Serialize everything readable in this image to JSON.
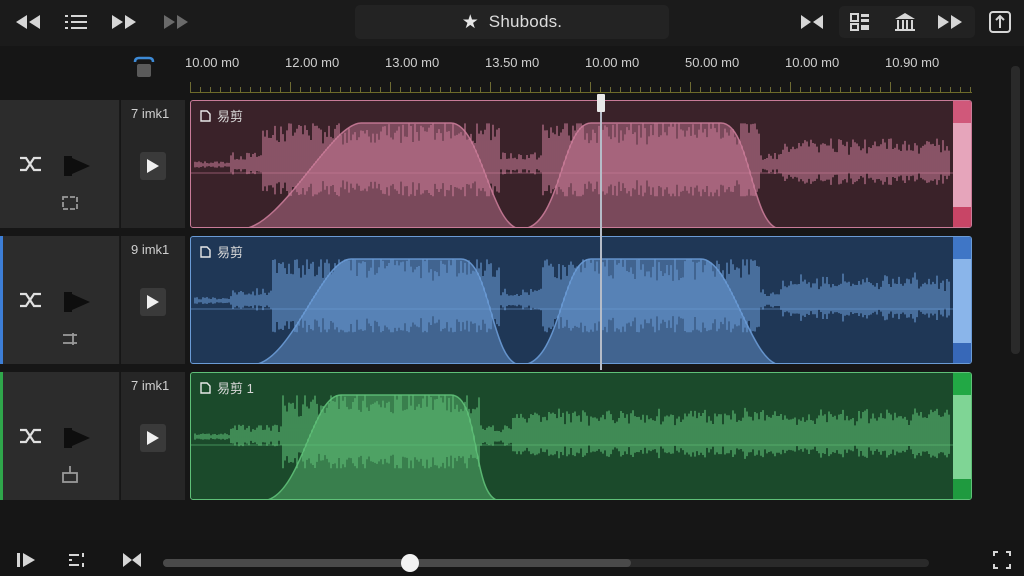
{
  "header": {
    "title": "Shubods.",
    "title_icon": "star-icon",
    "left_buttons": [
      "rewind-icon",
      "list-icon",
      "fast-forward-icon",
      "skip-forward-icon"
    ],
    "right_buttons": [
      "split-icon",
      "grid-icon",
      "bank-icon",
      "forward-icon",
      "share-icon"
    ]
  },
  "ruler": {
    "labels": [
      "10.00 m0",
      "12.00 m0",
      "13.00 m0",
      "13.50 m0",
      "10.00 m0",
      "50.00 m0",
      "10.00 m0",
      "10.90 m0"
    ]
  },
  "tracks": [
    {
      "number": "7 imk1",
      "clip_name": "易剪",
      "color": "#c97b98",
      "bg": "#3a2229",
      "side": "#c94d6b"
    },
    {
      "number": "9 imk1",
      "clip_name": "易剪",
      "color": "#6a9bd6",
      "bg": "#1f3756",
      "side": "#4a7fca"
    },
    {
      "number": "7 imk1",
      "clip_name": "易剪 1",
      "color": "#5fc078",
      "bg": "#1b4a2b",
      "side": "#3eb45b"
    }
  ],
  "playhead": {
    "position_label": "10.00 m0"
  },
  "footer": {
    "buttons": [
      "play-pause-icon",
      "mixer-icon",
      "bow-tie-icon",
      "expand-icon"
    ],
    "scroll_fraction": 0.32
  },
  "colors": {
    "background": "#161616",
    "ruler_accent": "#b6b02e",
    "pink": "#c97b98",
    "blue": "#6a9bd6",
    "green": "#5fc078"
  }
}
